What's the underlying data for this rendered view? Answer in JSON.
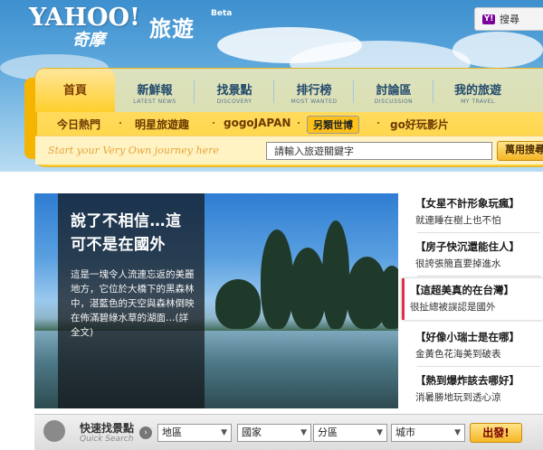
{
  "brand": {
    "logo_text": "YAHOO!",
    "sub_logo": "奇摩",
    "section": "旅遊",
    "beta": "Beta"
  },
  "top_search": {
    "label": "搜尋",
    "badge": "Y!"
  },
  "tabs": [
    {
      "zh": "首頁",
      "en": "",
      "active": true
    },
    {
      "zh": "新鮮報",
      "en": "LATEST NEWS"
    },
    {
      "zh": "找景點",
      "en": "DISCOVERY"
    },
    {
      "zh": "排行榜",
      "en": "MOST WANTED"
    },
    {
      "zh": "討論區",
      "en": "DISCUSSION"
    },
    {
      "zh": "我的旅遊",
      "en": "MY TRAVEL"
    }
  ],
  "subnav": [
    "今日熱門",
    "明星旅遊趣",
    "gogoJAPAN",
    "另類世博",
    "go好玩影片"
  ],
  "search": {
    "tagline": "Start your Very Own journey here",
    "placeholder": "請輸入旅遊關鍵字",
    "button": "萬用搜尋"
  },
  "feature": {
    "headline": "說了不相信…這可不是在國外",
    "description": "這是一塊令人流連忘返的美麗地方，它位於大橋下的黑森林中，湛藍色的天空與森林倒映在佈滿碧綠水草的湖面…(詳全文)"
  },
  "side_items": [
    {
      "title": "【女星不計形象玩瘋】",
      "subtitle": "就連睡在樹上也不怕"
    },
    {
      "title": "【房子快沉還能住人】",
      "subtitle": "很誇張簡直要掉進水"
    },
    {
      "title": "【這超美真的在台灣】",
      "subtitle": "很扯總被誤認是國外",
      "active": true
    },
    {
      "title": "【好像小瑞士是在哪】",
      "subtitle": "金黃色花海美到破表"
    },
    {
      "title": "【熱到爆炸該去哪好】",
      "subtitle": "消暑勝地玩到透心涼"
    }
  ],
  "quick_search": {
    "title": "快速找景點",
    "subtitle": "Quick Search",
    "selects": [
      "地區",
      "國家",
      "分區",
      "城市"
    ],
    "go": "出發!"
  },
  "colors": {
    "accent_yellow": "#ffd23c",
    "active_marker": "#e0314b",
    "sky_blue": "#3d8fce"
  }
}
